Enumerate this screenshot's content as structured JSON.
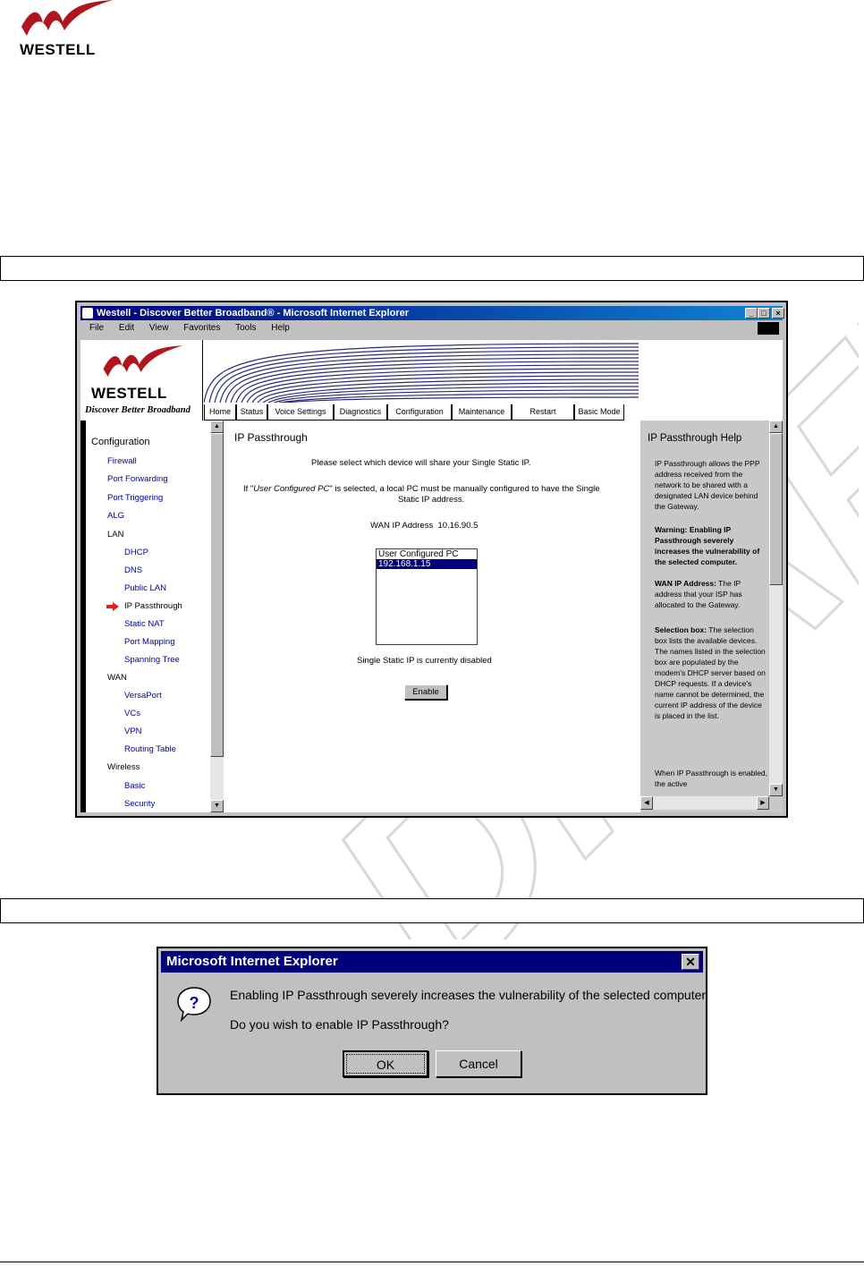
{
  "page": {
    "brand": "WESTELL",
    "watermark": "DRAFT"
  },
  "browser": {
    "title": "Westell - Discover Better Broadband® - Microsoft Internet Explorer",
    "menu": [
      "File",
      "Edit",
      "View",
      "Favorites",
      "Tools",
      "Help"
    ],
    "window_buttons": [
      "_",
      "□",
      "×"
    ]
  },
  "router": {
    "brand": "WESTELL",
    "tagline": "Discover Better Broadband",
    "nav_tabs": [
      "Home",
      "Status",
      "Voice Settings",
      "Diagnostics",
      "Configuration",
      "Maintenance",
      "Restart",
      "Basic Mode"
    ],
    "sidebar": {
      "heading": "Configuration",
      "items": [
        {
          "label": "Firewall",
          "level": 1
        },
        {
          "label": "Port Forwarding",
          "level": 1
        },
        {
          "label": "Port Triggering",
          "level": 1
        },
        {
          "label": "ALG",
          "level": 1
        },
        {
          "label": "LAN",
          "level": 1,
          "plain": true
        },
        {
          "label": "DHCP",
          "level": 2
        },
        {
          "label": "DNS",
          "level": 2
        },
        {
          "label": "Public LAN",
          "level": 2
        },
        {
          "label": "IP Passthrough",
          "level": 2,
          "active": true
        },
        {
          "label": "Static NAT",
          "level": 2
        },
        {
          "label": "Port Mapping",
          "level": 2
        },
        {
          "label": "Spanning Tree",
          "level": 2
        },
        {
          "label": "WAN",
          "level": 1,
          "plain": true
        },
        {
          "label": "VersaPort",
          "level": 2
        },
        {
          "label": "VCs",
          "level": 2
        },
        {
          "label": "VPN",
          "level": 2
        },
        {
          "label": "Routing Table",
          "level": 2
        },
        {
          "label": "Wireless",
          "level": 1,
          "plain": true
        },
        {
          "label": "Basic",
          "level": 2
        },
        {
          "label": "Security",
          "level": 2
        }
      ]
    },
    "main": {
      "title": "IP Passthrough",
      "instruction": "Please select which device will share your Single Static IP.",
      "note_prefix": "If \"",
      "note_em": "User Configured PC",
      "note_suffix": "\" is selected, a local PC must be manually configured to have the Single",
      "note_line2": "Static IP address.",
      "wan_ip_label": "WAN IP Address",
      "wan_ip_value": "10.16.90.5",
      "devices": [
        "User Configured PC",
        "192.168.1.15"
      ],
      "selected_device": "192.168.1.15",
      "status": "Single Static IP is currently disabled",
      "enable_label": "Enable"
    },
    "help": {
      "title": "IP Passthrough Help",
      "p1": "IP Passthrough allows the PPP address received from the network to be shared with a designated LAN device behind the Gateway.",
      "warning_bold": "Warning: Enabling IP Passthrough severely increases the vulnerability of the selected computer.",
      "wan_bold": "WAN IP Address:",
      "wan_text": " The IP address that your ISP has allocated to the Gateway.",
      "sel_bold": "Selection box:",
      "sel_text": " The selection box lists the available devices. The names listed in the selection box are populated by the modem's DHCP server based on DHCP requests. If a device's name cannot be determined, the current IP address of the device is placed in the list.",
      "p5": "When IP Passthrough is enabled, the active"
    }
  },
  "dialog": {
    "title": "Microsoft Internet Explorer",
    "message": "Enabling IP Passthrough severely increases the vulnerability of the selected computer",
    "question": "Do you wish to enable IP Passthrough?",
    "ok_label": "OK",
    "cancel_label": "Cancel"
  }
}
